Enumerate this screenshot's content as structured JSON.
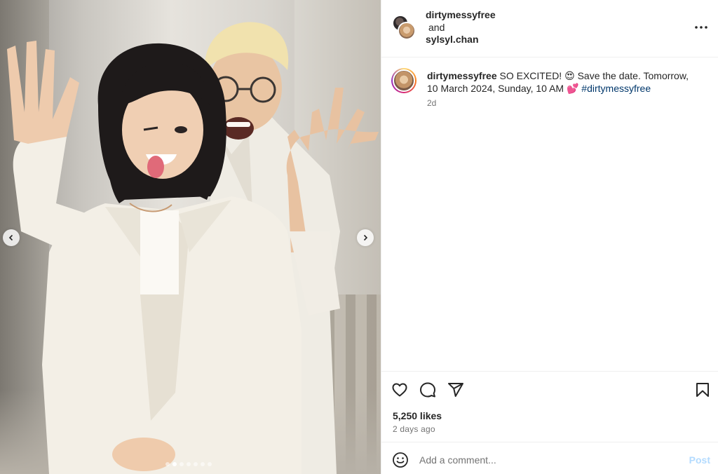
{
  "post": {
    "carousel": {
      "slide_count": 7,
      "active_slide": 2
    },
    "header": {
      "user1": "dirtymessyfree",
      "and_text": "and",
      "user2": "sylsyl.chan"
    },
    "caption": {
      "username": "dirtymessyfree",
      "text": "SO EXCITED! 😍 Save the date. Tomorrow, 10 March 2024, Sunday, 10 AM 💕",
      "hashtag": "#dirtymessyfree",
      "time": "2d"
    },
    "stats": {
      "likes": "5,250 likes",
      "ago": "2 days ago"
    },
    "comment_box": {
      "placeholder": "Add a comment...",
      "post_label": "Post"
    },
    "icons": {
      "more": "more-options-icon",
      "like": "heart-icon",
      "comment": "comment-icon",
      "share": "share-icon",
      "save": "bookmark-icon",
      "emoji": "emoji-icon",
      "prev": "chevron-left-icon",
      "next": "chevron-right-icon"
    },
    "colors": {
      "hashtag": "#00376b",
      "post_button": "#b3dbff",
      "muted": "#737373"
    }
  }
}
